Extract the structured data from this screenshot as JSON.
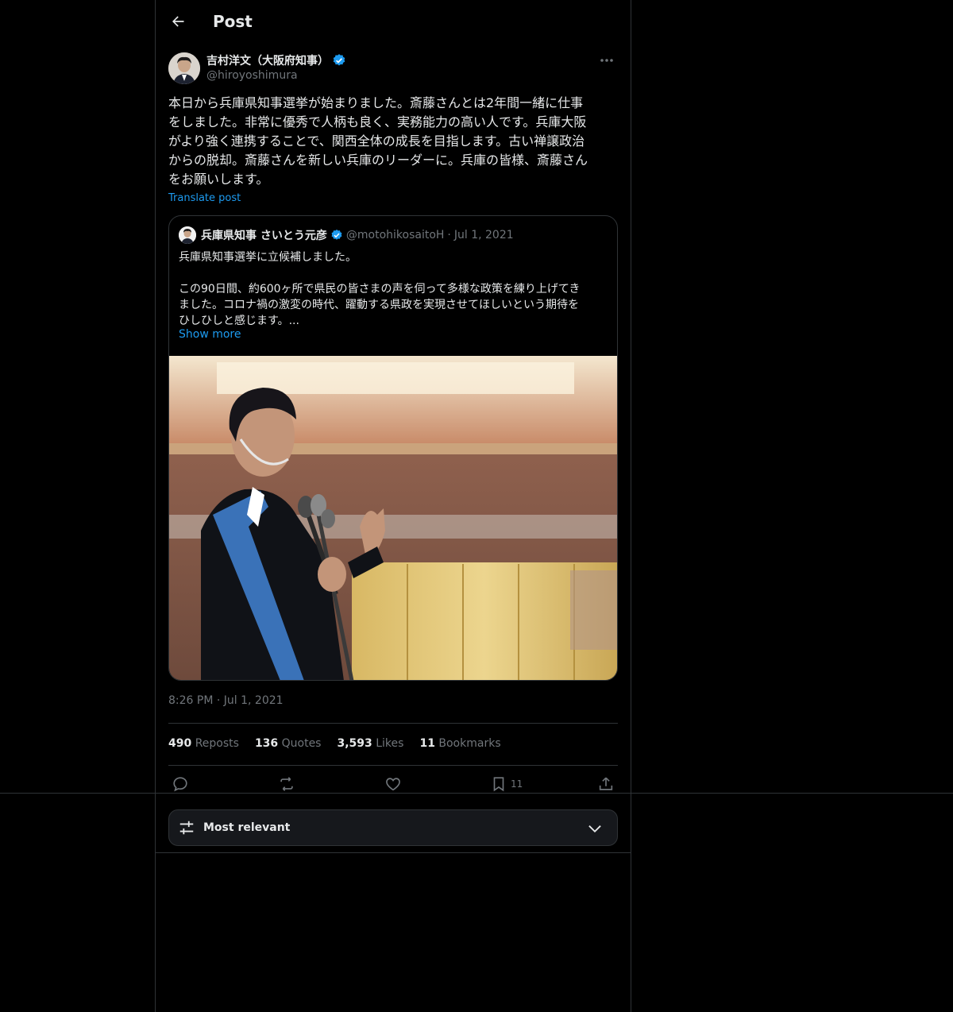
{
  "header": {
    "title": "Post"
  },
  "author": {
    "name": "吉村洋文（大阪府知事）",
    "handle": "@hiroyoshimura",
    "verified_color": "#1d9bf0"
  },
  "post": {
    "text": "本日から兵庫県知事選挙が始まりました。斎藤さんとは2年間一緒に仕事\nをしました。非常に優秀で人柄も良く、実務能力の高い人です。兵庫大阪\nがより強く連携することで、関西全体の成長を目指します。古い禅譲政治\nからの脱却。斎藤さんを新しい兵庫のリーダーに。兵庫の皆様、斎藤さん\nをお願いします。",
    "translate_label": "Translate post",
    "timestamp": "8:26 PM · Jul 1, 2021"
  },
  "quote": {
    "name": "兵庫県知事 さいとう元彦",
    "handle": "@motohikosaitoH",
    "separator": "·",
    "date": "Jul 1, 2021",
    "text": "兵庫県知事選挙に立候補しました。\n\nこの90日間、約600ヶ所で県民の皆さまの声を伺って多様な政策を練り上げてき\nました。コロナ禍の激変の時代、躍動する県政を実現させてほしいという期待を\nひしひしと感じます。...",
    "show_more": "Show more",
    "image_icon": "campaign-speech-photo"
  },
  "stats": {
    "reposts_count": "490",
    "reposts_label": "Reposts",
    "quotes_count": "136",
    "quotes_label": "Quotes",
    "likes_count": "3,593",
    "likes_label": "Likes",
    "bookmarks_count": "11",
    "bookmarks_label": "Bookmarks"
  },
  "actions": {
    "reply_icon": "reply-icon",
    "repost_icon": "repost-icon",
    "like_icon": "heart-icon",
    "bookmark_icon": "bookmark-icon",
    "bookmark_count": "11",
    "share_icon": "share-icon"
  },
  "sort": {
    "label": "Most relevant"
  },
  "colors": {
    "accent": "#1d9bf0",
    "text": "#e7e9ea",
    "muted": "#71767b",
    "border": "#2f3336"
  }
}
